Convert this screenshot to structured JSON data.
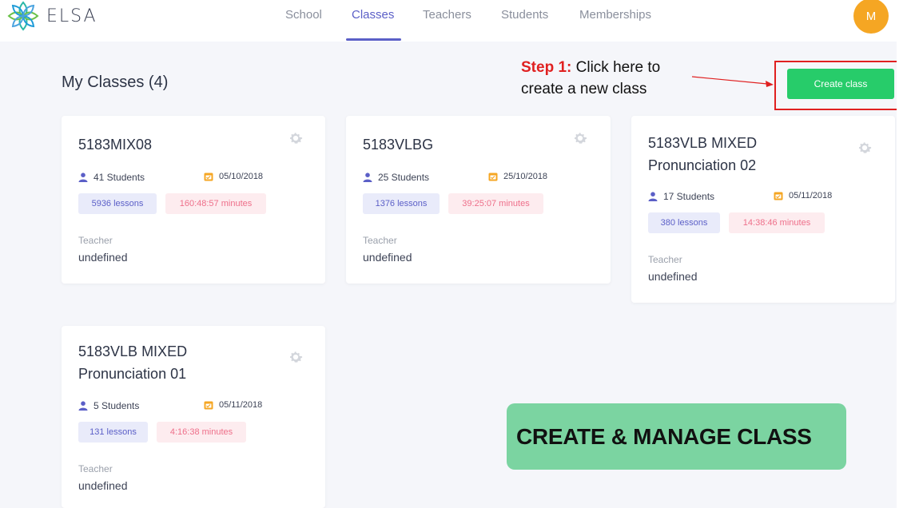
{
  "app": {
    "name": "ELSA"
  },
  "nav": {
    "items": [
      {
        "label": "School"
      },
      {
        "label": "Classes",
        "active": true
      },
      {
        "label": "Teachers"
      },
      {
        "label": "Students"
      },
      {
        "label": "Memberships"
      }
    ]
  },
  "user": {
    "initial": "M"
  },
  "page": {
    "title": "My Classes (4)"
  },
  "annotation": {
    "step_label": "Step 1:",
    "step_text_line1": " Click here to",
    "step_text_line2": "create a new class",
    "banner": "CREATE &  MANAGE CLASS"
  },
  "actions": {
    "create_class": "Create class"
  },
  "classes": [
    {
      "name": "5183MIX08",
      "students": "41 Students",
      "date": "05/10/2018",
      "lessons": "5936 lessons",
      "minutes": "160:48:57 minutes",
      "teacher_label": "Teacher",
      "teacher": "undefined"
    },
    {
      "name": "5183VLBG",
      "students": "25 Students",
      "date": "25/10/2018",
      "lessons": "1376 lessons",
      "minutes": "39:25:07 minutes",
      "teacher_label": "Teacher",
      "teacher": "undefined"
    },
    {
      "name": "5183VLB MIXED Pronunciation 02",
      "students": "17 Students",
      "date": "05/11/2018",
      "lessons": "380 lessons",
      "minutes": "14:38:46 minutes",
      "teacher_label": "Teacher",
      "teacher": "undefined"
    },
    {
      "name": "5183VLB MIXED Pronunciation 01",
      "students": "5 Students",
      "date": "05/11/2018",
      "lessons": "131 lessons",
      "minutes": "4:16:38 minutes",
      "teacher_label": "Teacher",
      "teacher": "undefined"
    }
  ],
  "colors": {
    "accent": "#5b5fc7",
    "create_button": "#27cc6a",
    "avatar": "#f5a623",
    "annotation_red": "#e02020",
    "banner": "#7bd4a1"
  }
}
